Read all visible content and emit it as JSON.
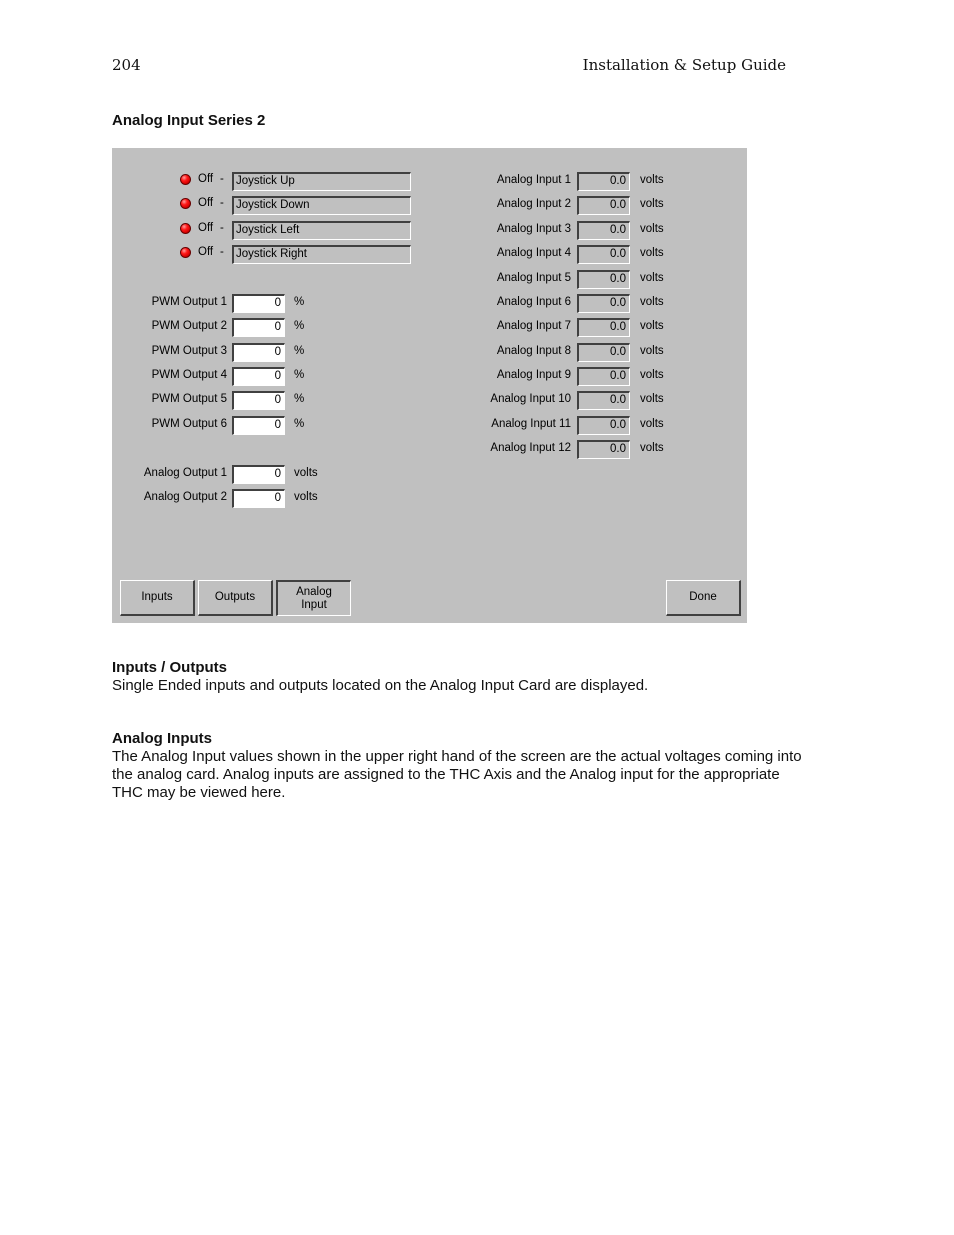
{
  "header": {
    "page_number": "204",
    "guide_title": "Installation & Setup Guide"
  },
  "section_title": "Analog Input Series 2",
  "panel": {
    "digital_inputs": [
      {
        "state": "Off",
        "separator": "-",
        "name": "Joystick Up"
      },
      {
        "state": "Off",
        "separator": "-",
        "name": "Joystick Down"
      },
      {
        "state": "Off",
        "separator": "-",
        "name": "Joystick Left"
      },
      {
        "state": "Off",
        "separator": "-",
        "name": "Joystick Right"
      }
    ],
    "led_color": "#ff0000",
    "pwm_outputs": [
      {
        "label": "PWM Output 1",
        "value": "0",
        "unit": "%"
      },
      {
        "label": "PWM Output 2",
        "value": "0",
        "unit": "%"
      },
      {
        "label": "PWM Output 3",
        "value": "0",
        "unit": "%"
      },
      {
        "label": "PWM Output 4",
        "value": "0",
        "unit": "%"
      },
      {
        "label": "PWM Output 5",
        "value": "0",
        "unit": "%"
      },
      {
        "label": "PWM Output 6",
        "value": "0",
        "unit": "%"
      }
    ],
    "analog_outputs": [
      {
        "label": "Analog Output 1",
        "value": "0",
        "unit": "volts"
      },
      {
        "label": "Analog Output 2",
        "value": "0",
        "unit": "volts"
      }
    ],
    "analog_inputs": [
      {
        "label": "Analog Input 1",
        "value": "0.0",
        "unit": "volts"
      },
      {
        "label": "Analog Input 2",
        "value": "0.0",
        "unit": "volts"
      },
      {
        "label": "Analog Input 3",
        "value": "0.0",
        "unit": "volts"
      },
      {
        "label": "Analog Input 4",
        "value": "0.0",
        "unit": "volts"
      },
      {
        "label": "Analog Input 5",
        "value": "0.0",
        "unit": "volts"
      },
      {
        "label": "Analog Input 6",
        "value": "0.0",
        "unit": "volts"
      },
      {
        "label": "Analog Input 7",
        "value": "0.0",
        "unit": "volts"
      },
      {
        "label": "Analog Input 8",
        "value": "0.0",
        "unit": "volts"
      },
      {
        "label": "Analog Input 9",
        "value": "0.0",
        "unit": "volts"
      },
      {
        "label": "Analog Input 10",
        "value": "0.0",
        "unit": "volts"
      },
      {
        "label": "Analog Input 11",
        "value": "0.0",
        "unit": "volts"
      },
      {
        "label": "Analog Input 12",
        "value": "0.0",
        "unit": "volts"
      }
    ],
    "buttons": {
      "inputs": "Inputs",
      "outputs": "Outputs",
      "analog_input_line1": "Analog",
      "analog_input_line2": "Input",
      "done": "Done"
    }
  },
  "body": {
    "inputs_outputs": {
      "heading": "Inputs / Outputs",
      "text": "Single Ended inputs and outputs located on the Analog Input Card are displayed."
    },
    "analog_inputs": {
      "heading": "Analog Inputs",
      "text": "The Analog Input values shown in the upper right hand of the screen are the actual voltages coming into the analog card.   Analog inputs are assigned to the THC Axis and the Analog input for the appropriate THC may be viewed here."
    }
  }
}
